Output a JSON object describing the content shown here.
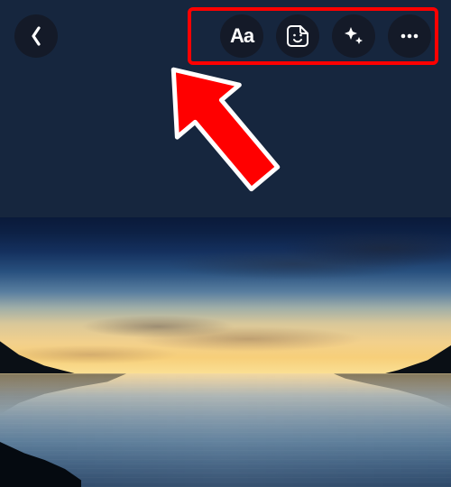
{
  "topbar": {
    "back_icon": "chevron-left",
    "tools": {
      "text_label": "Aa",
      "sticker_icon": "sticker-smile",
      "effects_icon": "sparkle",
      "more_icon": "ellipsis"
    }
  },
  "annotation": {
    "highlight_color": "#ff0000",
    "arrow_color": "#ff0000"
  }
}
